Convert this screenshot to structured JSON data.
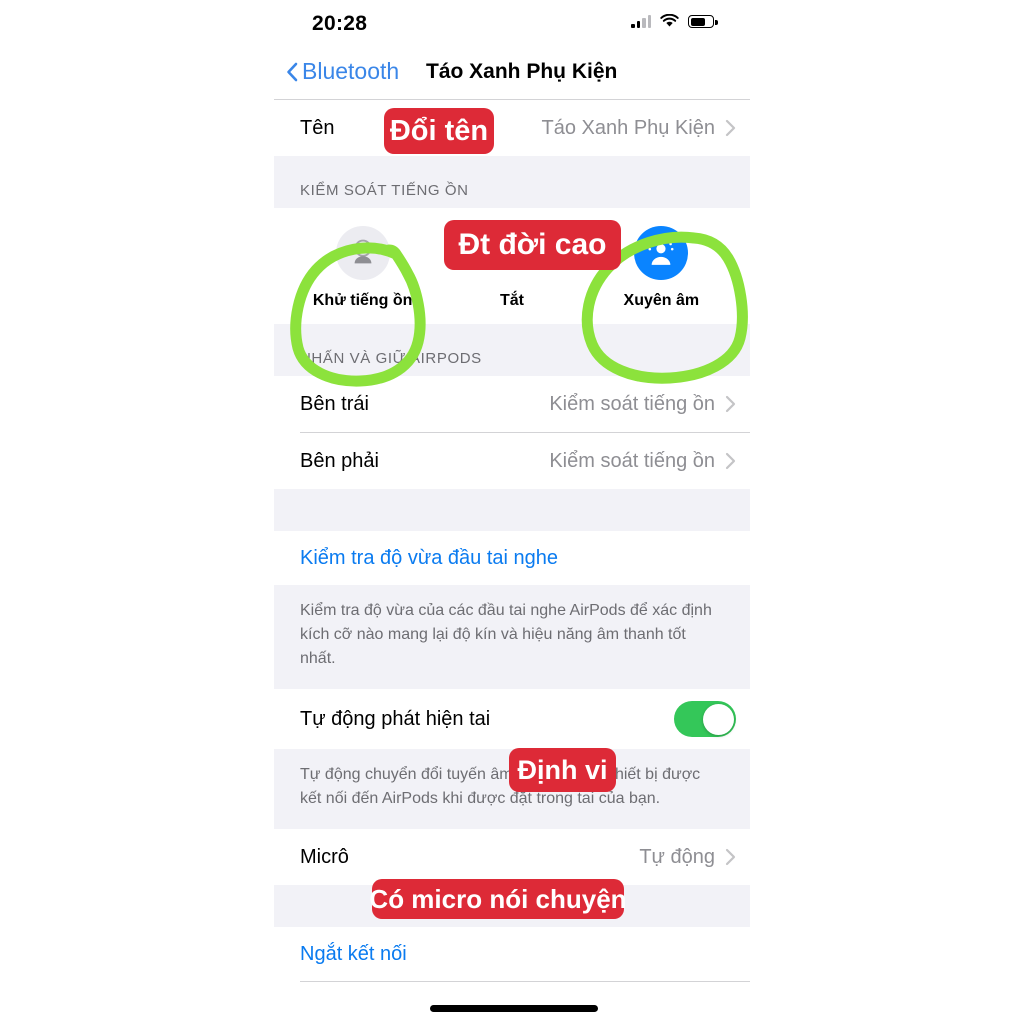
{
  "status_bar": {
    "time": "20:28",
    "icons": [
      "cellular-signal-icon",
      "wifi-icon",
      "battery-icon"
    ],
    "battery_level_pct": 60,
    "signal_bars_filled": 2
  },
  "nav": {
    "back_label": "Bluetooth",
    "title": "Táo Xanh Phụ Kiện"
  },
  "name_row": {
    "label": "Tên",
    "value": "Táo Xanh Phụ Kiện"
  },
  "noise_control": {
    "section_header": "KIỂM SOÁT TIẾNG ỒN",
    "options": [
      {
        "label": "Khử tiếng ồn",
        "icon": "noise-cancellation-icon",
        "selected": false
      },
      {
        "label": "Tắt",
        "icon": "noise-off-icon",
        "selected": false
      },
      {
        "label": "Xuyên âm",
        "icon": "transparency-icon",
        "selected": true
      }
    ]
  },
  "press_hold": {
    "section_header": "NHẤN VÀ GIỮ AIRPODS",
    "rows": [
      {
        "label": "Bên trái",
        "value": "Kiểm soát tiếng ồn"
      },
      {
        "label": "Bên phải",
        "value": "Kiểm soát tiếng ồn"
      }
    ]
  },
  "ear_tip_test": {
    "link": "Kiểm tra độ vừa đầu tai nghe",
    "footnote": "Kiểm tra độ vừa của các đầu tai nghe AirPods để xác định kích cỡ nào mang lại độ kín và hiệu năng âm thanh tốt nhất."
  },
  "auto_ear_detection": {
    "label": "Tự động phát hiện tai",
    "toggle_on": true,
    "footnote": "Tự động chuyển đổi tuyến âm thanh từ các thiết bị được kết nối đến AirPods khi được đặt trong tai của bạn."
  },
  "microphone": {
    "label": "Micrô",
    "value": "Tự động"
  },
  "disconnect": {
    "link": "Ngắt kết nối"
  },
  "annotations": {
    "badge_color": "#dd2a37",
    "circle_color": "#8CE23C",
    "badges": [
      {
        "id": "rename-badge",
        "text": "Đổi tên"
      },
      {
        "id": "high-end-phone-badge",
        "text": "Đt đời cao"
      },
      {
        "id": "locate-badge",
        "text": "Định vi"
      },
      {
        "id": "mic-talk-badge",
        "text": "Có micro nói chuyện"
      }
    ],
    "circles": [
      {
        "id": "noise-cancellation-circle",
        "target": "Khử tiếng ồn"
      },
      {
        "id": "transparency-circle",
        "target": "Xuyên âm"
      }
    ]
  }
}
